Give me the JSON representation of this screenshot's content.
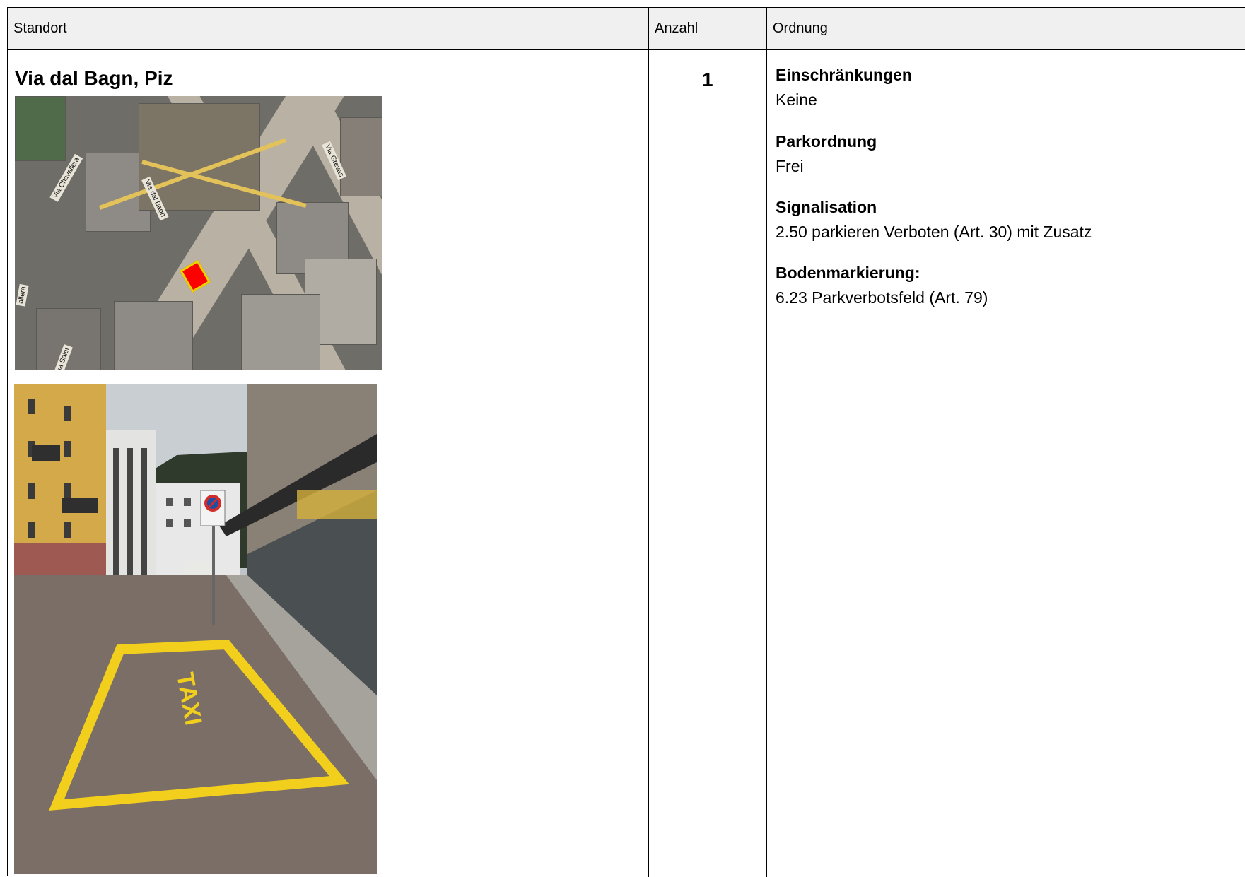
{
  "header": {
    "standort_label": "Standort",
    "anzahl_label": "Anzahl",
    "ordnung_label": "Ordnung"
  },
  "entry": {
    "location": "Via dal Bagn, Piz",
    "count": "1",
    "ordnung": [
      {
        "heading": "Einschränkungen",
        "value": "Keine"
      },
      {
        "heading": "Parkordnung",
        "value": "Frei"
      },
      {
        "heading": "Signalisation",
        "value": "2.50 parkieren Verboten (Art. 30) mit Zusatz"
      },
      {
        "heading": "Bodenmarkierung:",
        "value": "6.23 Parkverbotsfeld (Art. 79)"
      }
    ]
  },
  "map": {
    "street_labels": [
      "Via Chavallera",
      "Via dal Bagn",
      "Via Grevas",
      "Via Salet",
      "allera"
    ],
    "marker_color": "#ff0000",
    "marker_border_color": "#e8d400"
  },
  "photo": {
    "marking_text": "TAXI",
    "marking_color": "#f2cf1d"
  },
  "colors": {
    "header_bg": "#f0f0f0",
    "grid": "#000000"
  }
}
